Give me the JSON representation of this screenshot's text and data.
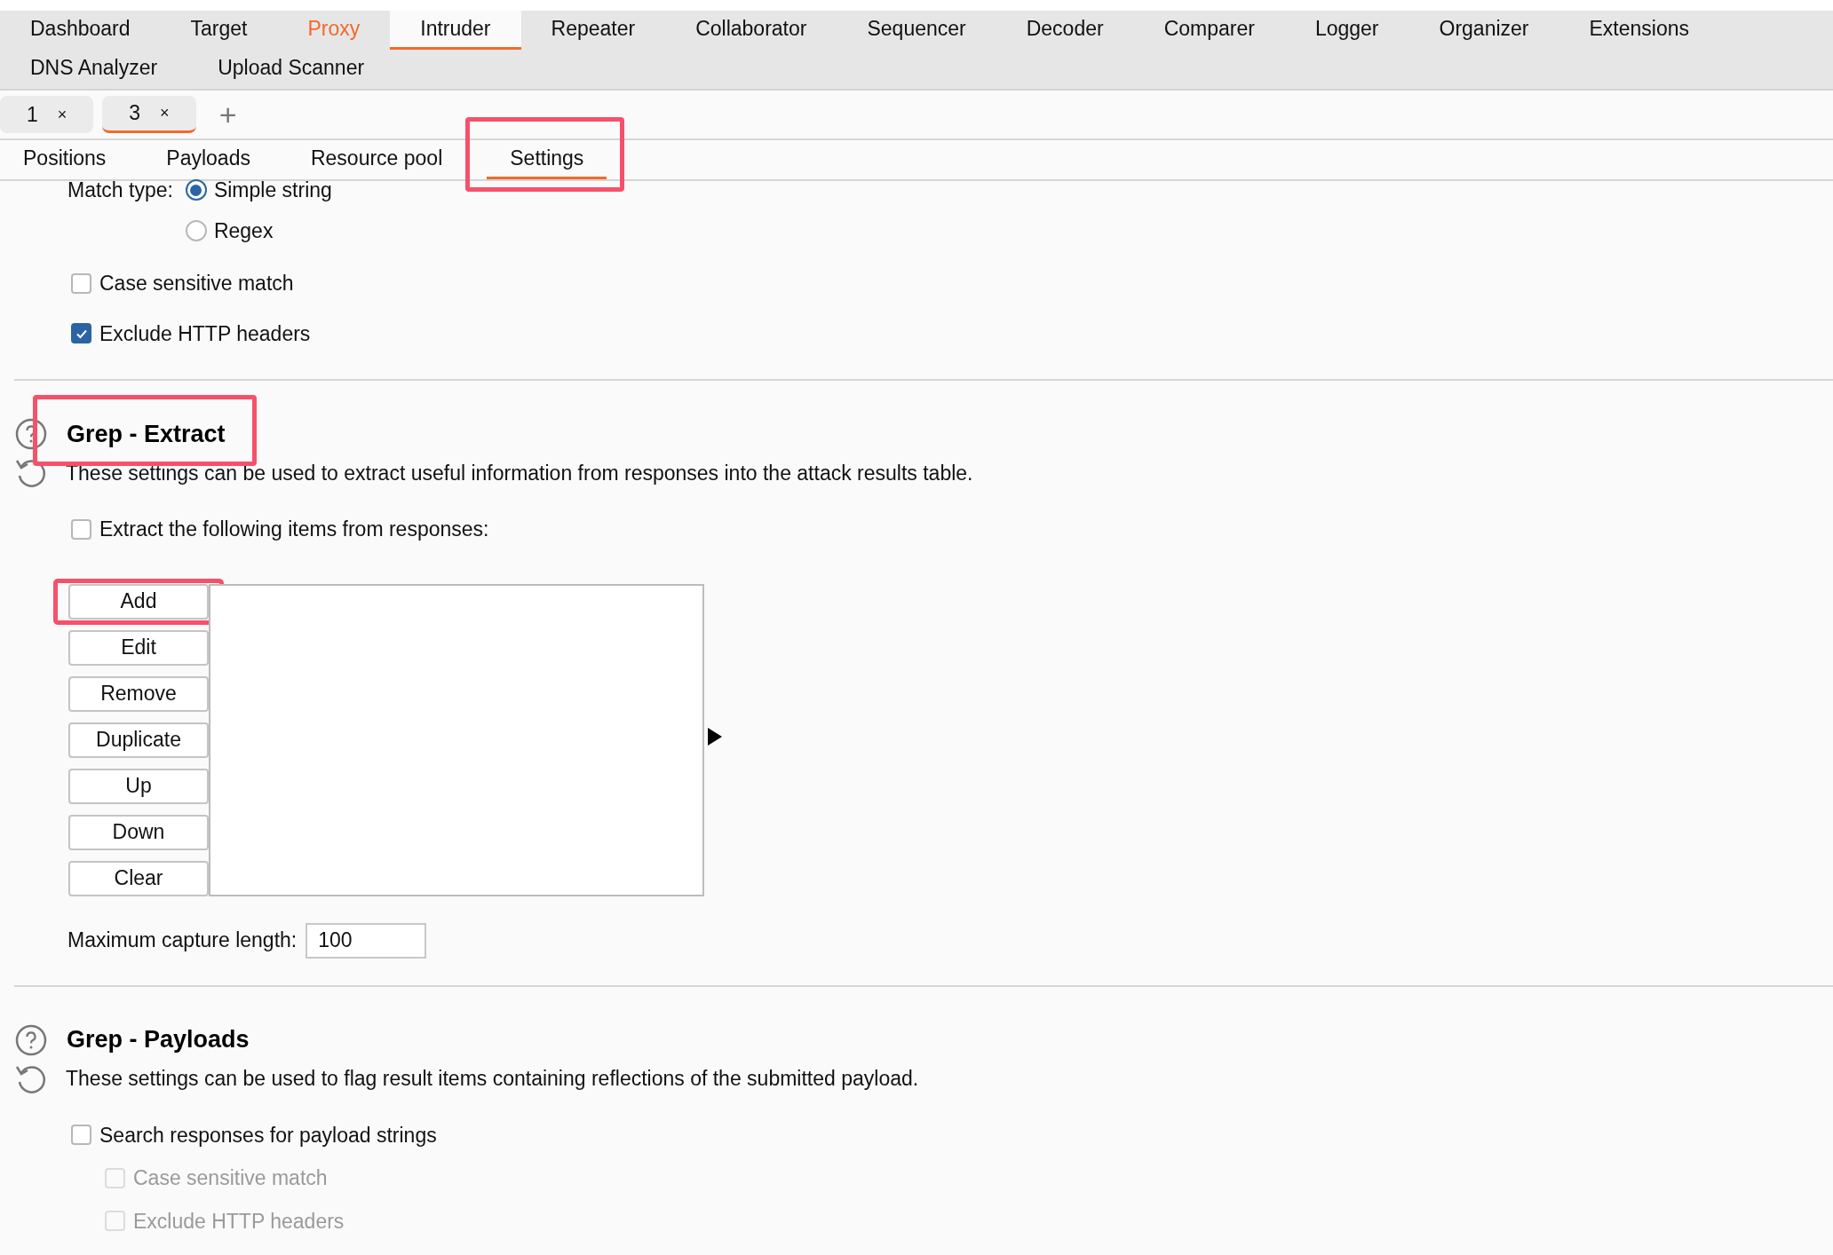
{
  "tool_tabs": [
    {
      "label": "Dashboard",
      "selected": false,
      "kind": "normal"
    },
    {
      "label": "Target",
      "selected": false,
      "kind": "normal"
    },
    {
      "label": "Proxy",
      "selected": false,
      "kind": "alert"
    },
    {
      "label": "Intruder",
      "selected": true,
      "kind": "normal"
    },
    {
      "label": "Repeater",
      "selected": false,
      "kind": "normal"
    },
    {
      "label": "Collaborator",
      "selected": false,
      "kind": "normal"
    },
    {
      "label": "Sequencer",
      "selected": false,
      "kind": "normal"
    },
    {
      "label": "Decoder",
      "selected": false,
      "kind": "normal"
    },
    {
      "label": "Comparer",
      "selected": false,
      "kind": "normal"
    },
    {
      "label": "Logger",
      "selected": false,
      "kind": "normal"
    },
    {
      "label": "Organizer",
      "selected": false,
      "kind": "normal"
    },
    {
      "label": "Extensions",
      "selected": false,
      "kind": "normal"
    },
    {
      "label": "DNS Analyzer",
      "selected": false,
      "kind": "normal"
    },
    {
      "label": "Upload Scanner",
      "selected": false,
      "kind": "normal"
    }
  ],
  "attack_tabs": [
    {
      "label": "1",
      "close": "×",
      "selected": false
    },
    {
      "label": "3",
      "close": "×",
      "selected": true
    }
  ],
  "new_tab": "+",
  "sub_tabs": [
    {
      "label": "Positions",
      "selected": false,
      "highlighted": false
    },
    {
      "label": "Payloads",
      "selected": false,
      "highlighted": false
    },
    {
      "label": "Resource pool",
      "selected": false,
      "highlighted": false
    },
    {
      "label": "Settings",
      "selected": true,
      "highlighted": true
    }
  ],
  "match_type": {
    "label": "Match type:",
    "options": [
      {
        "label": "Simple string",
        "selected": true
      },
      {
        "label": "Regex",
        "selected": false
      }
    ]
  },
  "match_options": [
    {
      "label": "Case sensitive match",
      "checked": false
    },
    {
      "label": "Exclude HTTP headers",
      "checked": true
    }
  ],
  "grep_extract": {
    "title": "Grep - Extract",
    "highlighted": true,
    "description": "These settings can be used to extract useful information from responses into the attack results table.",
    "enable": {
      "label": "Extract the following items from responses:",
      "checked": false
    },
    "buttons": [
      {
        "label": "Add",
        "highlighted": true
      },
      {
        "label": "Edit",
        "highlighted": false
      },
      {
        "label": "Remove",
        "highlighted": false
      },
      {
        "label": "Duplicate",
        "highlighted": false
      },
      {
        "label": "Up",
        "highlighted": false
      },
      {
        "label": "Down",
        "highlighted": false
      },
      {
        "label": "Clear",
        "highlighted": false
      }
    ],
    "max_length": {
      "label": "Maximum capture length:",
      "value": "100"
    }
  },
  "grep_payloads": {
    "title": "Grep - Payloads",
    "description": "These settings can be used to flag result items containing reflections of the submitted payload.",
    "enable": {
      "label": "Search responses for payload strings",
      "checked": false
    },
    "options": [
      {
        "label": "Case sensitive match",
        "checked": false,
        "disabled": true
      },
      {
        "label": "Exclude HTTP headers",
        "checked": false,
        "disabled": true
      }
    ]
  }
}
